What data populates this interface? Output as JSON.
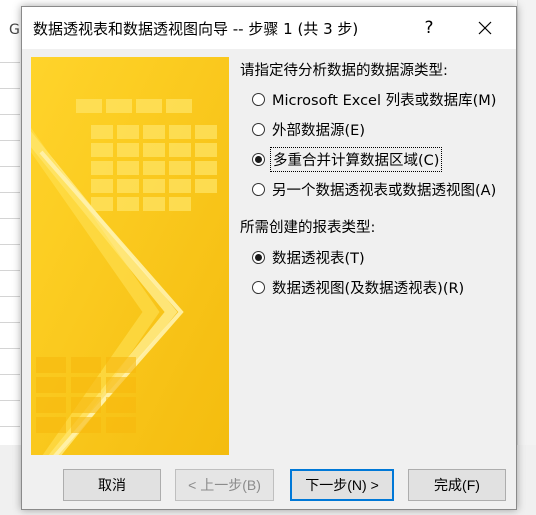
{
  "background": {
    "column_letter": "G"
  },
  "dialog": {
    "title": "数据透视表和数据透视图向导 -- 步骤 1 (共 3 步)",
    "help_label": "?",
    "close_icon": "close-icon",
    "source_section_label": "请指定待分析数据的数据源类型:",
    "source_options": [
      {
        "label": "Microsoft Excel 列表或数据库(M)",
        "checked": false
      },
      {
        "label": "外部数据源(E)",
        "checked": false
      },
      {
        "label": "多重合并计算数据区域(C)",
        "checked": true,
        "focused": true
      },
      {
        "label": "另一个数据透视表或数据透视图(A)",
        "checked": false
      }
    ],
    "report_section_label": "所需创建的报表类型:",
    "report_options": [
      {
        "label": "数据透视表(T)",
        "checked": true
      },
      {
        "label": "数据透视图(及数据透视表)(R)",
        "checked": false
      }
    ],
    "buttons": {
      "cancel": "取消",
      "back": "< 上一步(B)",
      "next": "下一步(N) >",
      "finish": "完成(F)"
    }
  },
  "colors": {
    "illustration_base": "#f7c400",
    "illustration_light": "#ffe04a",
    "default_button_border": "#0078d7"
  }
}
